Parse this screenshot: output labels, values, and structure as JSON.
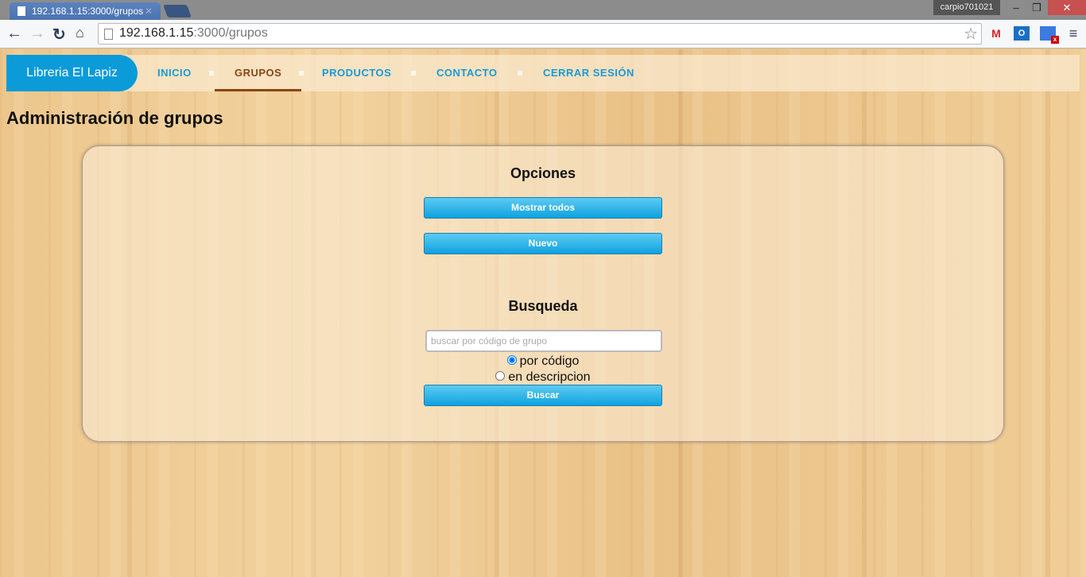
{
  "browser": {
    "tab_title": "192.168.1.15:3000/grupos",
    "url_host": "192.168.1.15",
    "url_path": ":3000/grupos",
    "user": "carpio701021"
  },
  "nav": {
    "brand": "Libreria El Lapiz",
    "items": [
      {
        "label": "INICIO"
      },
      {
        "label": "GRUPOS"
      },
      {
        "label": "PRODUCTOS"
      },
      {
        "label": "CONTACTO"
      },
      {
        "label": "CERRAR SESIÓN"
      }
    ],
    "active": "GRUPOS"
  },
  "page": {
    "title": "Administración de grupos"
  },
  "options": {
    "heading": "Opciones",
    "show_all": "Mostrar todos",
    "new": "Nuevo"
  },
  "search": {
    "heading": "Busqueda",
    "placeholder": "buscar por código de grupo",
    "value": "",
    "radio_code": "por código",
    "radio_desc": "en descripcion",
    "selected": "por código",
    "button": "Buscar"
  }
}
